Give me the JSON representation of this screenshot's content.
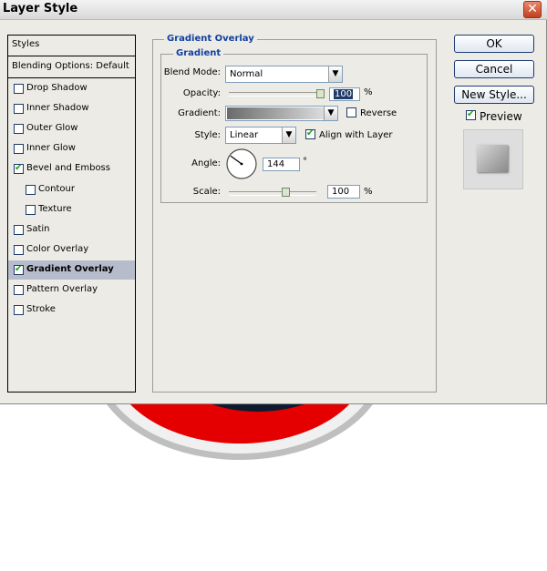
{
  "window": {
    "title": "Layer Style"
  },
  "styles_panel": {
    "header": "Styles",
    "blending": "Blending Options: Default",
    "items": [
      {
        "label": "Drop Shadow",
        "checked": false
      },
      {
        "label": "Inner Shadow",
        "checked": false
      },
      {
        "label": "Outer Glow",
        "checked": false
      },
      {
        "label": "Inner Glow",
        "checked": false
      },
      {
        "label": "Bevel and Emboss",
        "checked": true
      },
      {
        "label": "Contour",
        "checked": false
      },
      {
        "label": "Texture",
        "checked": false
      },
      {
        "label": "Satin",
        "checked": false
      },
      {
        "label": "Color Overlay",
        "checked": false
      },
      {
        "label": "Gradient Overlay",
        "checked": true
      },
      {
        "label": "Pattern Overlay",
        "checked": false
      },
      {
        "label": "Stroke",
        "checked": false
      }
    ],
    "selected": "Gradient Overlay"
  },
  "gradient_overlay": {
    "title": "Gradient Overlay",
    "group": "Gradient",
    "blend_mode_label": "Blend Mode:",
    "blend_mode": "Normal",
    "opacity_label": "Opacity:",
    "opacity": "100",
    "opacity_unit": "%",
    "opacity_level": 1.0,
    "gradient_label": "Gradient:",
    "reverse_label": "Reverse",
    "reverse_checked": false,
    "style_label": "Style:",
    "style": "Linear",
    "align_label": "Align with Layer",
    "align_checked": true,
    "angle_label": "Angle:",
    "angle": "144",
    "angle_unit": "°",
    "scale_label": "Scale:",
    "scale": "100",
    "scale_unit": "%",
    "scale_level": 0.6
  },
  "buttons": {
    "ok": "OK",
    "cancel": "Cancel",
    "new_style": "New Style...",
    "preview": "Preview",
    "preview_checked": true
  },
  "colors": {
    "accent": "#1040a0",
    "selected_row": "#b6bccc",
    "artwork_red": "#e40000"
  }
}
